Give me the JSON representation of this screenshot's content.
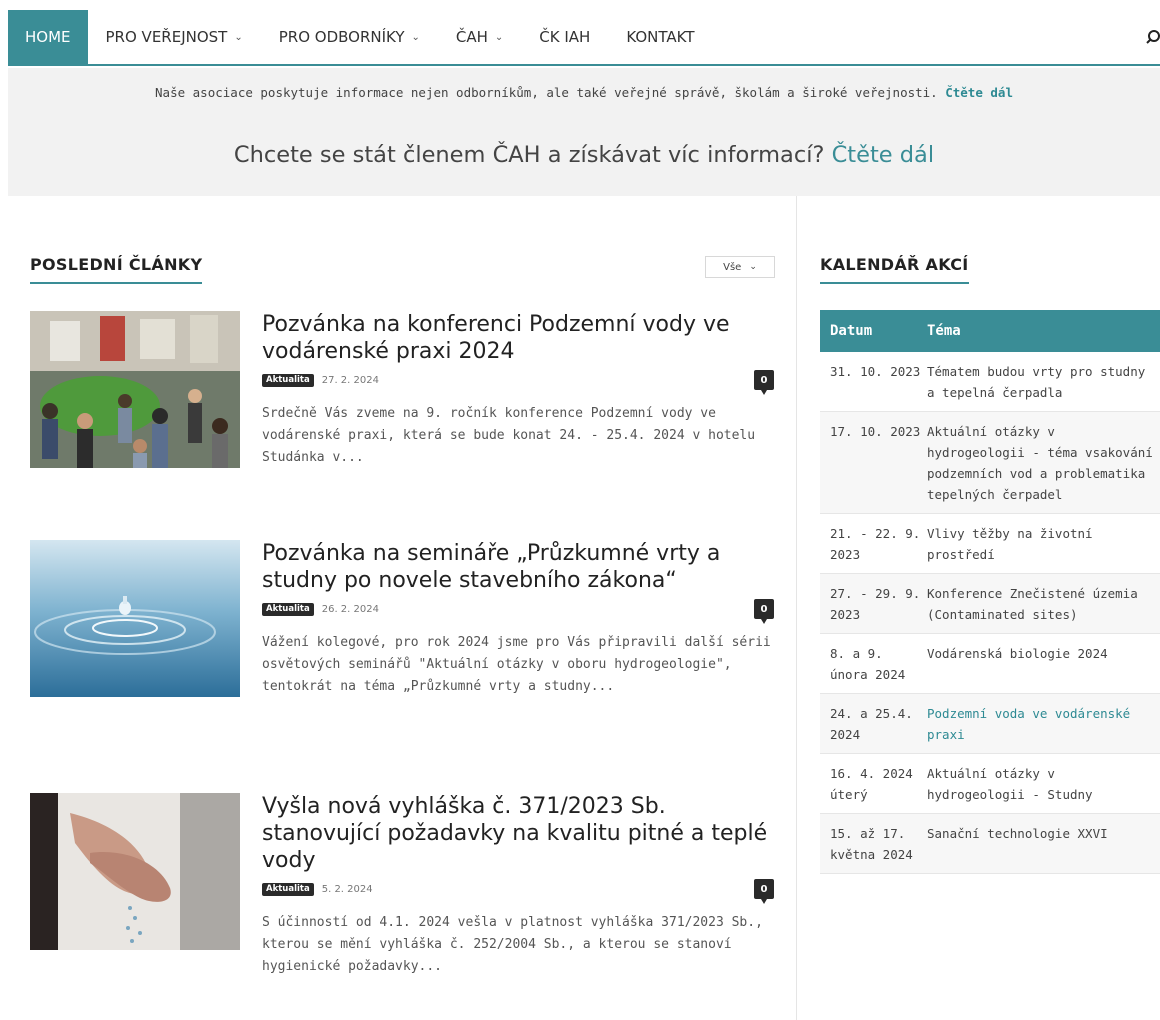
{
  "nav": {
    "items": [
      {
        "label": "HOME",
        "dropdown": false,
        "active": true
      },
      {
        "label": "PRO VEŘEJNOST",
        "dropdown": true,
        "active": false
      },
      {
        "label": "PRO ODBORNÍKY",
        "dropdown": true,
        "active": false
      },
      {
        "label": "ČAH",
        "dropdown": true,
        "active": false
      },
      {
        "label": "ČK IAH",
        "dropdown": false,
        "active": false
      },
      {
        "label": "KONTAKT",
        "dropdown": false,
        "active": false
      }
    ],
    "search_icon": "search-icon"
  },
  "notice": {
    "small_text": "Naše asociace poskytuje informace nejen odborníkům, ale také veřejné správě, školám a široké veřejnosti.",
    "small_link": "Čtěte dál",
    "big_text": "Chcete se stát členem ČAH a získávat víc informací?",
    "big_link": "Čtěte dál"
  },
  "articles_section": {
    "title": "POSLEDNÍ ČLÁNKY",
    "filter_value": "Vše"
  },
  "articles": [
    {
      "title": "Pozvánka na konferenci Podzemní vody ve vodárenské praxi 2024",
      "badge": "Aktualita",
      "date": "27. 2. 2024",
      "comments": "0",
      "excerpt": "Srdečně Vás zveme na 9. ročník konference Podzemní vody ve vodárenské praxi, která se bude konat 24. - 25.4. 2024 v hotelu Studánka v..."
    },
    {
      "title": "Pozvánka na semináře „Průzkumné vrty a studny po novele stavebního zákona“",
      "badge": "Aktualita",
      "date": "26. 2. 2024",
      "comments": "0",
      "excerpt": "Vážení kolegové, pro rok 2024 jsme pro Vás připravili další sérii osvětových seminářů \"Aktuální otázky v oboru hydrogeologie\", tentokrát na téma „Průzkumné vrty a studny..."
    },
    {
      "title": "Vyšla nová vyhláška č. 371/2023 Sb. stanovující požadavky na kvalitu pitné a teplé vody",
      "badge": "Aktualita",
      "date": "5. 2. 2024",
      "comments": "0",
      "excerpt": "S účinností od 4.1. 2024 vešla v platnost vyhláška 371/2023 Sb., kterou se mění vyhláška č. 252/2004 Sb., a kterou se stanoví hygienické požadavky..."
    }
  ],
  "calendar": {
    "title": "KALENDÁŘ AKCÍ",
    "headers": {
      "date": "Datum",
      "topic": "Téma"
    },
    "rows": [
      {
        "date": "31. 10. 2023",
        "topic": "Tématem budou vrty pro studny a tepelná čerpadla",
        "link": false
      },
      {
        "date": "17. 10. 2023",
        "topic": "Aktuální otázky v hydrogeologii - téma vsakování podzemních vod a problematika tepelných čerpadel",
        "link": false
      },
      {
        "date": "21. - 22. 9. 2023",
        "topic": "Vlivy těžby na životní prostředí",
        "link": false
      },
      {
        "date": "27. - 29. 9. 2023",
        "topic": "Konference Znečistené územia (Contaminated sites)",
        "link": false
      },
      {
        "date": "8. a 9. února 2024",
        "topic": "Vodárenská biologie 2024",
        "link": false
      },
      {
        "date": "24. a 25.4. 2024",
        "topic": "Podzemní voda ve vodárenské praxi",
        "link": true
      },
      {
        "date": "16. 4. 2024 úterý",
        "topic": "Aktuální otázky v hydrogeologii - Studny",
        "link": false
      },
      {
        "date": "15. až 17. května 2024",
        "topic": "Sanační technologie XXVI",
        "link": false
      }
    ]
  },
  "colors": {
    "accent": "#3a8d96",
    "link": "#2e8a93",
    "badge": "#2a2a2a",
    "band": "#f2f2f2"
  }
}
